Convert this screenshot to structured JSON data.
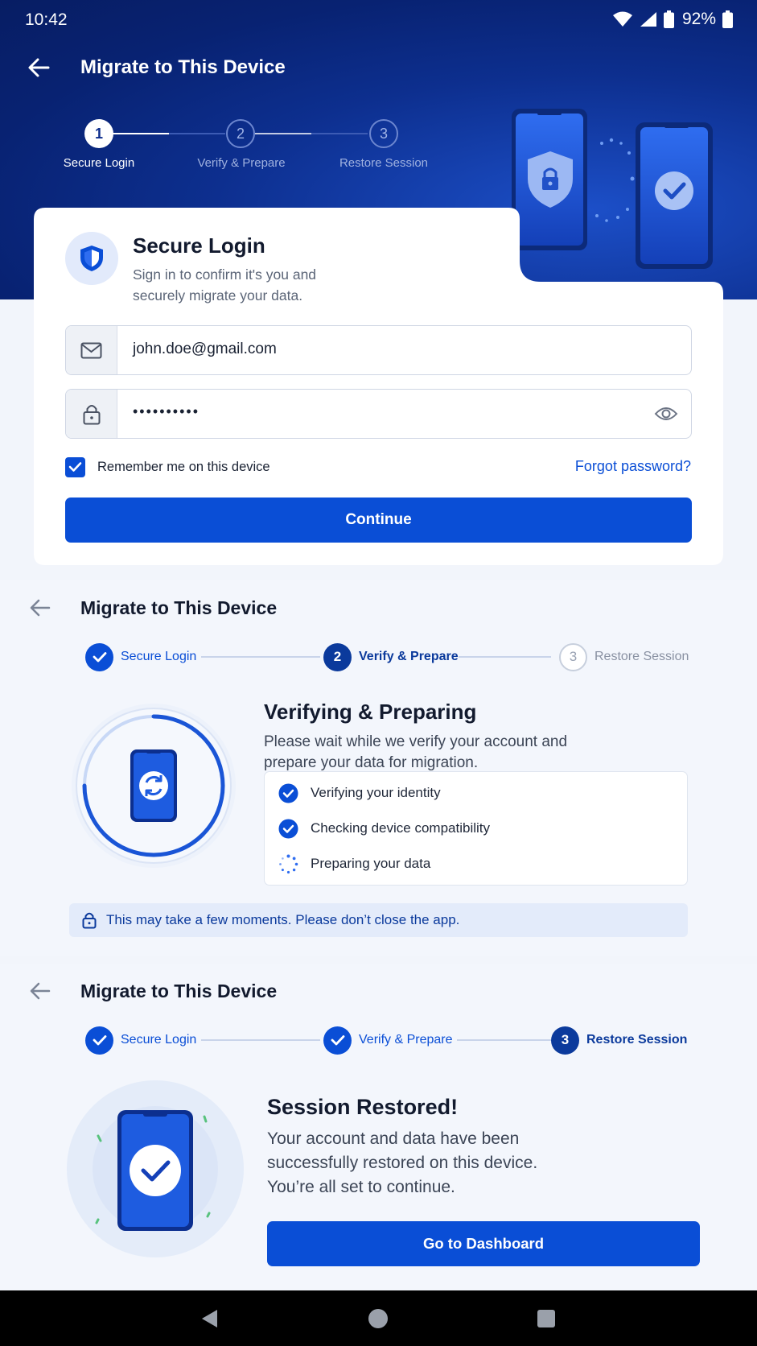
{
  "status_bar": {
    "time": "10:42",
    "battery": "92%"
  },
  "login_screen": {
    "title": "Migrate to This Device",
    "steps": [
      {
        "number": "1",
        "label": "Secure Login"
      },
      {
        "number": "2",
        "label": "Verify & Prepare"
      },
      {
        "number": "3",
        "label": "Restore Session"
      }
    ],
    "card": {
      "title": "Secure Login",
      "subtitle": "Sign in to confirm it's you and securely migrate your data.",
      "email_value": "john.doe@gmail.com",
      "password_value": "••••••••••",
      "remember_label": "Remember me on this device",
      "remember_checked": true,
      "forgot_label": "Forgot password?",
      "continue_label": "Continue"
    }
  },
  "verify_screen": {
    "title": "Migrate to This Device",
    "steps": [
      {
        "number": "",
        "label": "Secure Login",
        "state": "done"
      },
      {
        "number": "2",
        "label": "Verify & Prepare",
        "state": "current"
      },
      {
        "number": "3",
        "label": "Restore Session",
        "state": "idle"
      }
    ],
    "heading": "Verifying & Preparing",
    "description": "Please wait while we verify your account and prepare your data for migration.",
    "checklist": [
      {
        "label": "Verifying your identity",
        "status": "done"
      },
      {
        "label": "Checking device compatibility",
        "status": "done"
      },
      {
        "label": "Preparing your data",
        "status": "in-progress"
      }
    ],
    "notice": "This may take a few moments. Please don’t close the app."
  },
  "restore_screen": {
    "title": "Migrate to This Device",
    "steps": [
      {
        "number": "",
        "label": "Secure Login",
        "state": "done"
      },
      {
        "number": "",
        "label": "Verify & Prepare",
        "state": "done"
      },
      {
        "number": "3",
        "label": "Restore Session",
        "state": "current"
      }
    ],
    "heading": "Session Restored!",
    "description": "Your account and data have been successfully restored on this device. You’re all set to continue.",
    "button_label": "Go to Dashboard"
  },
  "colors": {
    "primary": "#0a4ed6",
    "hero_dark": "#071d63",
    "step_current": "#0b3a9c",
    "page_bg": "#f3f6fc"
  },
  "icons": [
    "wifi-icon",
    "signal-icon",
    "battery-icon",
    "back-arrow-icon",
    "shield-icon",
    "mail-icon",
    "lock-icon",
    "eye-icon",
    "checkbox-check-icon",
    "check-icon",
    "sync-icon",
    "spinner-icon",
    "phone-icon",
    "nav-back-icon",
    "nav-home-icon",
    "nav-recents-icon"
  ]
}
